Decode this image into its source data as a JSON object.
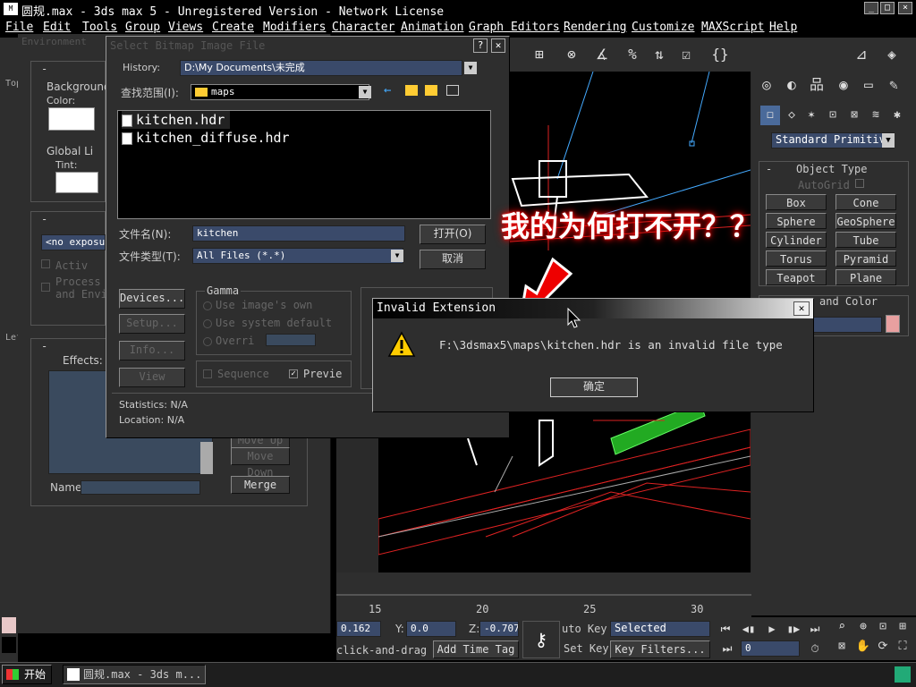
{
  "window": {
    "title": "圆规.max - 3ds max 5 - Unregistered Version - Network License",
    "controls": [
      "_",
      "□",
      "×"
    ]
  },
  "menu": [
    "File",
    "Edit",
    "Tools",
    "Group",
    "Views",
    "Create",
    "Modifiers",
    "Character",
    "Animation",
    "Graph Editors",
    "Rendering",
    "Customize",
    "MAXScript",
    "Help"
  ],
  "env_panel": {
    "title": "Environment",
    "background_label": "Background",
    "color_label": "Color:",
    "global_lighting_label": "Global Li",
    "tint_label": "Tint:",
    "exposure_select": "<no exposure",
    "active_label": "Activ",
    "process_label": "Process",
    "and_env_label": "and Envi",
    "effects_label": "Effects:",
    "name_label": "Name:",
    "merge_button": "Merge",
    "move_down_button": "Move Down",
    "move_up_button": "Move Up",
    "viewport_labels": {
      "top": "Top",
      "left": "Lef"
    }
  },
  "file_dialog": {
    "title": "Select Bitmap Image File",
    "history_label": "History:",
    "history_value": "D:\\My Documents\\未完成",
    "lookin_label": "查找范围(I):",
    "lookin_value": "maps",
    "files": [
      "kitchen.hdr",
      "kitchen_diffuse.hdr"
    ],
    "filename_label": "文件名(N):",
    "filename_value": "kitchen",
    "filetype_label": "文件类型(T):",
    "filetype_value": "All Files (*.*)",
    "open_button": "打开(O)",
    "cancel_button": "取消",
    "devices_button": "Devices...",
    "setup_button": "Setup...",
    "info_button": "Info...",
    "view_button": "View",
    "gamma_label": "Gamma",
    "gamma_opt1": "Use image's own",
    "gamma_opt2": "Use system default",
    "gamma_opt3": "Overri",
    "sequence_label": "Sequence",
    "preview_label": "Previe",
    "statistics": "Statistics: N/A",
    "location": "Location: N/A"
  },
  "error_dialog": {
    "title": "Invalid Extension",
    "message": "F:\\3dsmax5\\maps\\kitchen.hdr is an invalid file type",
    "ok_button": "确定"
  },
  "annotation": "我的为何打不开？？",
  "command_panel": {
    "dropdown": "Standard Primitiv",
    "object_type_label": "Object Type",
    "autogrid_label": "AutoGrid",
    "objects": [
      "Box",
      "Cone",
      "Sphere",
      "GeoSphere",
      "Cylinder",
      "Tube",
      "Torus",
      "Pyramid",
      "Teapot",
      "Plane"
    ],
    "name_color_label": "and Color"
  },
  "timeline": {
    "ticks": [
      "15",
      "20",
      "25",
      "30"
    ]
  },
  "status": {
    "x_value": "0.162",
    "y_label": "Y:",
    "y_value": "0.0",
    "z_label": "Z:",
    "z_value": "-0.707",
    "auto_key": "uto Key",
    "set_key": "Set Key",
    "selected": "Selected",
    "key_filters": "Key Filters...",
    "frame_value": "0",
    "prompt": "click-and-drag",
    "add_time_tag": "Add Time Tag"
  },
  "taskbar": {
    "start": "开始",
    "task": "圆规.max - 3ds m..."
  },
  "colors": {
    "annotation_glow": "#e00000",
    "error_arrow": "#e00000",
    "name_swatch": "#e8a0a0"
  }
}
